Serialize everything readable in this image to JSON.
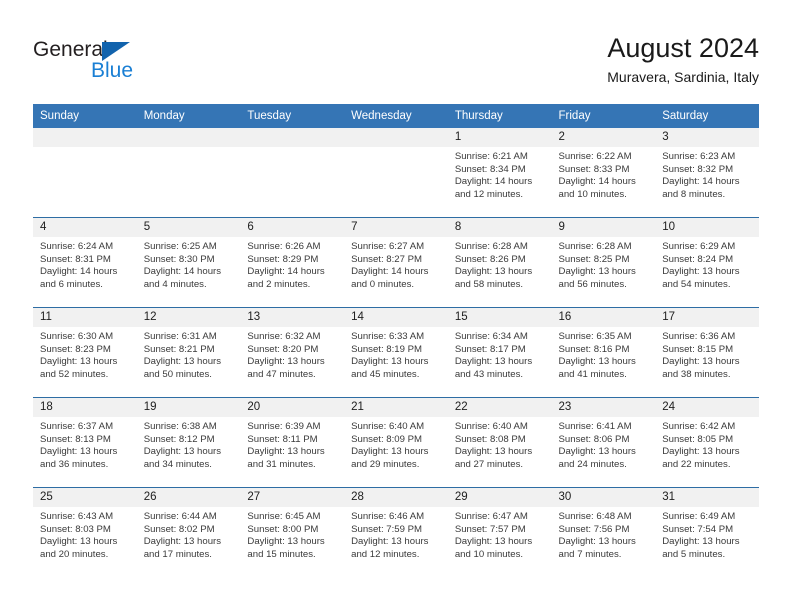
{
  "brand": {
    "name_part1": "General",
    "name_part2": "Blue",
    "triangle_icon": "blue-triangle-icon",
    "colors": {
      "dark": "#231f20",
      "blue": "#1a7fd4",
      "triangle": "#1263ad"
    }
  },
  "header": {
    "title": "August 2024",
    "location": "Muravera, Sardinia, Italy"
  },
  "theme": {
    "header_blue": "#3575b5",
    "row_divider": "#2e6da4",
    "daynum_band": "#f1f1f1"
  },
  "weekday_headers": [
    "Sunday",
    "Monday",
    "Tuesday",
    "Wednesday",
    "Thursday",
    "Friday",
    "Saturday"
  ],
  "weeks": [
    [
      {
        "day": "",
        "sunrise": "",
        "sunset": "",
        "daylight_line1": "",
        "daylight_line2": ""
      },
      {
        "day": "",
        "sunrise": "",
        "sunset": "",
        "daylight_line1": "",
        "daylight_line2": ""
      },
      {
        "day": "",
        "sunrise": "",
        "sunset": "",
        "daylight_line1": "",
        "daylight_line2": ""
      },
      {
        "day": "",
        "sunrise": "",
        "sunset": "",
        "daylight_line1": "",
        "daylight_line2": ""
      },
      {
        "day": "1",
        "sunrise": "Sunrise: 6:21 AM",
        "sunset": "Sunset: 8:34 PM",
        "daylight_line1": "Daylight: 14 hours",
        "daylight_line2": "and 12 minutes."
      },
      {
        "day": "2",
        "sunrise": "Sunrise: 6:22 AM",
        "sunset": "Sunset: 8:33 PM",
        "daylight_line1": "Daylight: 14 hours",
        "daylight_line2": "and 10 minutes."
      },
      {
        "day": "3",
        "sunrise": "Sunrise: 6:23 AM",
        "sunset": "Sunset: 8:32 PM",
        "daylight_line1": "Daylight: 14 hours",
        "daylight_line2": "and 8 minutes."
      }
    ],
    [
      {
        "day": "4",
        "sunrise": "Sunrise: 6:24 AM",
        "sunset": "Sunset: 8:31 PM",
        "daylight_line1": "Daylight: 14 hours",
        "daylight_line2": "and 6 minutes."
      },
      {
        "day": "5",
        "sunrise": "Sunrise: 6:25 AM",
        "sunset": "Sunset: 8:30 PM",
        "daylight_line1": "Daylight: 14 hours",
        "daylight_line2": "and 4 minutes."
      },
      {
        "day": "6",
        "sunrise": "Sunrise: 6:26 AM",
        "sunset": "Sunset: 8:29 PM",
        "daylight_line1": "Daylight: 14 hours",
        "daylight_line2": "and 2 minutes."
      },
      {
        "day": "7",
        "sunrise": "Sunrise: 6:27 AM",
        "sunset": "Sunset: 8:27 PM",
        "daylight_line1": "Daylight: 14 hours",
        "daylight_line2": "and 0 minutes."
      },
      {
        "day": "8",
        "sunrise": "Sunrise: 6:28 AM",
        "sunset": "Sunset: 8:26 PM",
        "daylight_line1": "Daylight: 13 hours",
        "daylight_line2": "and 58 minutes."
      },
      {
        "day": "9",
        "sunrise": "Sunrise: 6:28 AM",
        "sunset": "Sunset: 8:25 PM",
        "daylight_line1": "Daylight: 13 hours",
        "daylight_line2": "and 56 minutes."
      },
      {
        "day": "10",
        "sunrise": "Sunrise: 6:29 AM",
        "sunset": "Sunset: 8:24 PM",
        "daylight_line1": "Daylight: 13 hours",
        "daylight_line2": "and 54 minutes."
      }
    ],
    [
      {
        "day": "11",
        "sunrise": "Sunrise: 6:30 AM",
        "sunset": "Sunset: 8:23 PM",
        "daylight_line1": "Daylight: 13 hours",
        "daylight_line2": "and 52 minutes."
      },
      {
        "day": "12",
        "sunrise": "Sunrise: 6:31 AM",
        "sunset": "Sunset: 8:21 PM",
        "daylight_line1": "Daylight: 13 hours",
        "daylight_line2": "and 50 minutes."
      },
      {
        "day": "13",
        "sunrise": "Sunrise: 6:32 AM",
        "sunset": "Sunset: 8:20 PM",
        "daylight_line1": "Daylight: 13 hours",
        "daylight_line2": "and 47 minutes."
      },
      {
        "day": "14",
        "sunrise": "Sunrise: 6:33 AM",
        "sunset": "Sunset: 8:19 PM",
        "daylight_line1": "Daylight: 13 hours",
        "daylight_line2": "and 45 minutes."
      },
      {
        "day": "15",
        "sunrise": "Sunrise: 6:34 AM",
        "sunset": "Sunset: 8:17 PM",
        "daylight_line1": "Daylight: 13 hours",
        "daylight_line2": "and 43 minutes."
      },
      {
        "day": "16",
        "sunrise": "Sunrise: 6:35 AM",
        "sunset": "Sunset: 8:16 PM",
        "daylight_line1": "Daylight: 13 hours",
        "daylight_line2": "and 41 minutes."
      },
      {
        "day": "17",
        "sunrise": "Sunrise: 6:36 AM",
        "sunset": "Sunset: 8:15 PM",
        "daylight_line1": "Daylight: 13 hours",
        "daylight_line2": "and 38 minutes."
      }
    ],
    [
      {
        "day": "18",
        "sunrise": "Sunrise: 6:37 AM",
        "sunset": "Sunset: 8:13 PM",
        "daylight_line1": "Daylight: 13 hours",
        "daylight_line2": "and 36 minutes."
      },
      {
        "day": "19",
        "sunrise": "Sunrise: 6:38 AM",
        "sunset": "Sunset: 8:12 PM",
        "daylight_line1": "Daylight: 13 hours",
        "daylight_line2": "and 34 minutes."
      },
      {
        "day": "20",
        "sunrise": "Sunrise: 6:39 AM",
        "sunset": "Sunset: 8:11 PM",
        "daylight_line1": "Daylight: 13 hours",
        "daylight_line2": "and 31 minutes."
      },
      {
        "day": "21",
        "sunrise": "Sunrise: 6:40 AM",
        "sunset": "Sunset: 8:09 PM",
        "daylight_line1": "Daylight: 13 hours",
        "daylight_line2": "and 29 minutes."
      },
      {
        "day": "22",
        "sunrise": "Sunrise: 6:40 AM",
        "sunset": "Sunset: 8:08 PM",
        "daylight_line1": "Daylight: 13 hours",
        "daylight_line2": "and 27 minutes."
      },
      {
        "day": "23",
        "sunrise": "Sunrise: 6:41 AM",
        "sunset": "Sunset: 8:06 PM",
        "daylight_line1": "Daylight: 13 hours",
        "daylight_line2": "and 24 minutes."
      },
      {
        "day": "24",
        "sunrise": "Sunrise: 6:42 AM",
        "sunset": "Sunset: 8:05 PM",
        "daylight_line1": "Daylight: 13 hours",
        "daylight_line2": "and 22 minutes."
      }
    ],
    [
      {
        "day": "25",
        "sunrise": "Sunrise: 6:43 AM",
        "sunset": "Sunset: 8:03 PM",
        "daylight_line1": "Daylight: 13 hours",
        "daylight_line2": "and 20 minutes."
      },
      {
        "day": "26",
        "sunrise": "Sunrise: 6:44 AM",
        "sunset": "Sunset: 8:02 PM",
        "daylight_line1": "Daylight: 13 hours",
        "daylight_line2": "and 17 minutes."
      },
      {
        "day": "27",
        "sunrise": "Sunrise: 6:45 AM",
        "sunset": "Sunset: 8:00 PM",
        "daylight_line1": "Daylight: 13 hours",
        "daylight_line2": "and 15 minutes."
      },
      {
        "day": "28",
        "sunrise": "Sunrise: 6:46 AM",
        "sunset": "Sunset: 7:59 PM",
        "daylight_line1": "Daylight: 13 hours",
        "daylight_line2": "and 12 minutes."
      },
      {
        "day": "29",
        "sunrise": "Sunrise: 6:47 AM",
        "sunset": "Sunset: 7:57 PM",
        "daylight_line1": "Daylight: 13 hours",
        "daylight_line2": "and 10 minutes."
      },
      {
        "day": "30",
        "sunrise": "Sunrise: 6:48 AM",
        "sunset": "Sunset: 7:56 PM",
        "daylight_line1": "Daylight: 13 hours",
        "daylight_line2": "and 7 minutes."
      },
      {
        "day": "31",
        "sunrise": "Sunrise: 6:49 AM",
        "sunset": "Sunset: 7:54 PM",
        "daylight_line1": "Daylight: 13 hours",
        "daylight_line2": "and 5 minutes."
      }
    ]
  ]
}
